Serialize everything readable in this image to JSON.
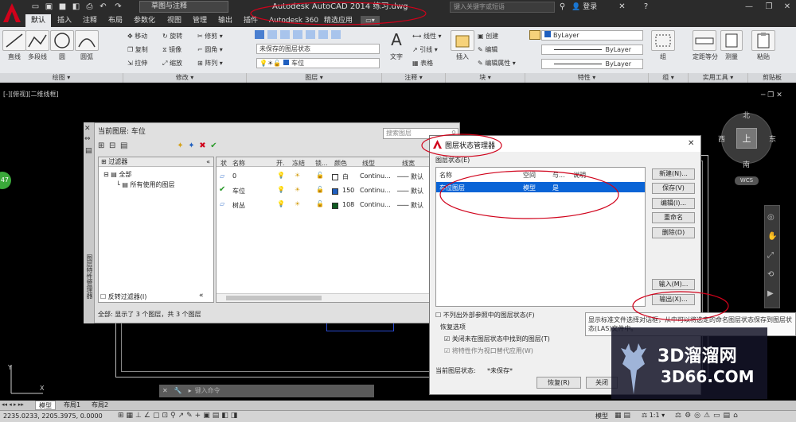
{
  "titlebar": {
    "workspace": "草图与注释",
    "app_title": "Autodesk AutoCAD 2014    练习.dwg",
    "search_placeholder": "键入关键字或短语",
    "login": "登录"
  },
  "tabs": [
    "默认",
    "插入",
    "注释",
    "布局",
    "参数化",
    "视图",
    "管理",
    "输出",
    "插件",
    "Autodesk 360",
    "精选应用"
  ],
  "ribbon": {
    "draw": {
      "title": "绘图",
      "tools": [
        "直线",
        "多段线",
        "圆",
        "圆弧"
      ]
    },
    "modify": {
      "title": "修改",
      "tools": [
        "移动",
        "旋转",
        "修剪",
        "复制",
        "镜像",
        "圆角",
        "拉伸",
        "缩放",
        "阵列"
      ]
    },
    "layers": {
      "title": "图层",
      "state": "未保存的图层状态",
      "current": "车位"
    },
    "annotation": {
      "title": "注释",
      "text": "文字",
      "tools": [
        "线性",
        "引线",
        "表格"
      ]
    },
    "block": {
      "title": "块",
      "insert": "插入",
      "tools": [
        "创建",
        "编辑",
        "编辑属性"
      ]
    },
    "properties": {
      "title": "特性",
      "bylayer": [
        "ByLayer",
        "ByLayer",
        "ByLayer"
      ]
    },
    "groups": {
      "title": "组",
      "label": "组"
    },
    "utilities": {
      "title": "实用工具",
      "measure": "测量",
      "tools": [
        "定距等分"
      ]
    },
    "clipboard": {
      "title": "剪贴板",
      "paste": "粘贴"
    }
  },
  "viewport_label": "[-][俯视][二维线框]",
  "viewcube": {
    "north": "北",
    "south": "南",
    "east": "东",
    "west": "西",
    "top": "上",
    "wcs": "WCS"
  },
  "layer_palette": {
    "current_layer": "当前图层: 车位",
    "search_placeholder": "搜索图层",
    "filter_header": "过滤器",
    "tree": [
      "全部",
      "所有使用的图层"
    ],
    "invert_filter": "反转过滤器(I)",
    "columns": [
      "状",
      "名称",
      "开.",
      "冻结",
      "锁...",
      "颜色",
      "线型",
      "线宽"
    ],
    "rows": [
      {
        "name": "0",
        "color": "白",
        "linetype": "Continu...",
        "lineweight": "默认",
        "swatch": "#ffffff"
      },
      {
        "name": "车位",
        "color": "150",
        "linetype": "Continu...",
        "lineweight": "默认",
        "swatch": "#1f5fbf"
      },
      {
        "name": "树丛",
        "color": "108",
        "linetype": "Continu...",
        "lineweight": "默认",
        "swatch": "#0f5a20"
      }
    ],
    "status": "全部: 显示了 3 个图层，共 3 个图层",
    "side_title": "图层特性管理器"
  },
  "layer_state_dialog": {
    "title": "图层状态管理器",
    "list_label": "图层状态(E)",
    "columns": [
      "名称",
      "空间",
      "与...",
      "说明"
    ],
    "row": {
      "name": "车位图层",
      "space": "模型",
      "same": "是",
      "desc": ""
    },
    "buttons": [
      "新建(N)...",
      "保存(V)",
      "编辑(I)...",
      "重命名",
      "删除(D)",
      "输入(M)...",
      "输出(X)..."
    ],
    "exclude_xref": "不列出外部参照中的图层状态(F)",
    "restore_options": "恢复选项",
    "close_unfound": "关闭未在图层状态中找到的图层(T)",
    "apply_viewport": "将特性作为视口替代应用(W)",
    "current_state_label": "当前图层状态:",
    "current_state_value": "*未保存*",
    "restore_btn": "恢复(R)",
    "close_btn": "关闭"
  },
  "tooltip": "显示标准文件选择对话框，从中可以将选定的命名图层状态保存到图层状态(LAS)文件中。",
  "command_placeholder": "键入命令",
  "layout_tabs": [
    "模型",
    "布局1",
    "布局2"
  ],
  "status": {
    "coords": "2235.0233, 2205.3975, 0.0000",
    "mode": "模型",
    "scale": "1:1"
  },
  "watermark": {
    "brand": "3D溜溜网",
    "url": "3D66.COM"
  },
  "side_badge": "47",
  "colors": {
    "accent_red": "#d0021b",
    "selection_blue": "#0a64d6"
  }
}
